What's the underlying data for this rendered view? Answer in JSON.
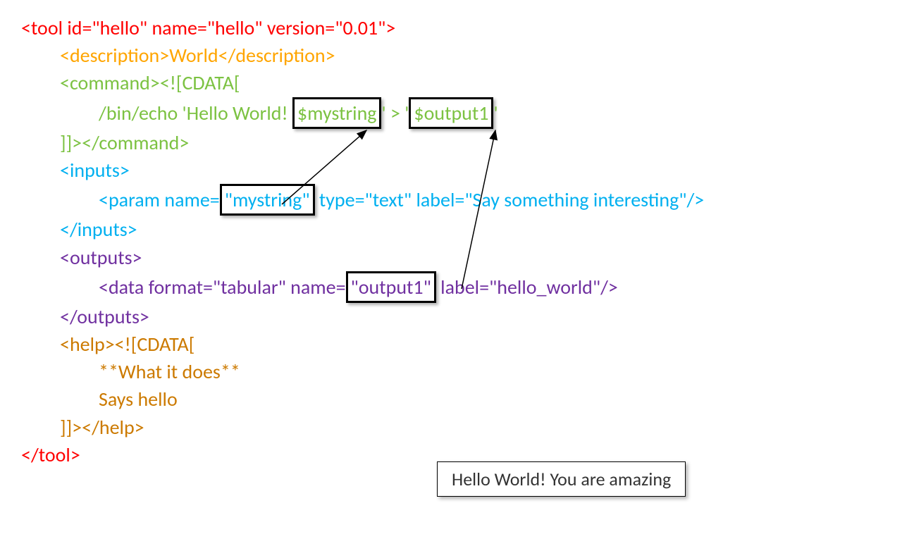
{
  "code": {
    "tool_open": "<tool id=\"hello\" name=\"hello\" version=\"0.01\">",
    "description": "<description>World</description>",
    "command_open": "<command><![CDATA[",
    "command_body_prefix": "/bin/echo 'Hello World! ",
    "command_mystring": "$mystring",
    "command_mid": "' > '",
    "command_output": "$output1",
    "command_suffix": "'",
    "command_close": "]]></command>",
    "inputs_open": "<inputs>",
    "param_prefix": "<param name=",
    "param_mystring": "\"mystring\"",
    "param_suffix": " type=\"text\" label=\"Say something interesting\"/>",
    "inputs_close": "</inputs>",
    "outputs_open": "<outputs>",
    "data_prefix": "<data format=\"tabular\" name=",
    "data_output": "\"output1\"",
    "data_suffix": " label=\"hello_world\"/>",
    "outputs_close": "</outputs>",
    "help_open": "<help><![CDATA[",
    "help_line1": "**What it does**",
    "help_line2": "Says hello",
    "help_close": "]]></help>",
    "tool_close": "</tool>"
  },
  "output_text": "Hello World! You are amazing"
}
